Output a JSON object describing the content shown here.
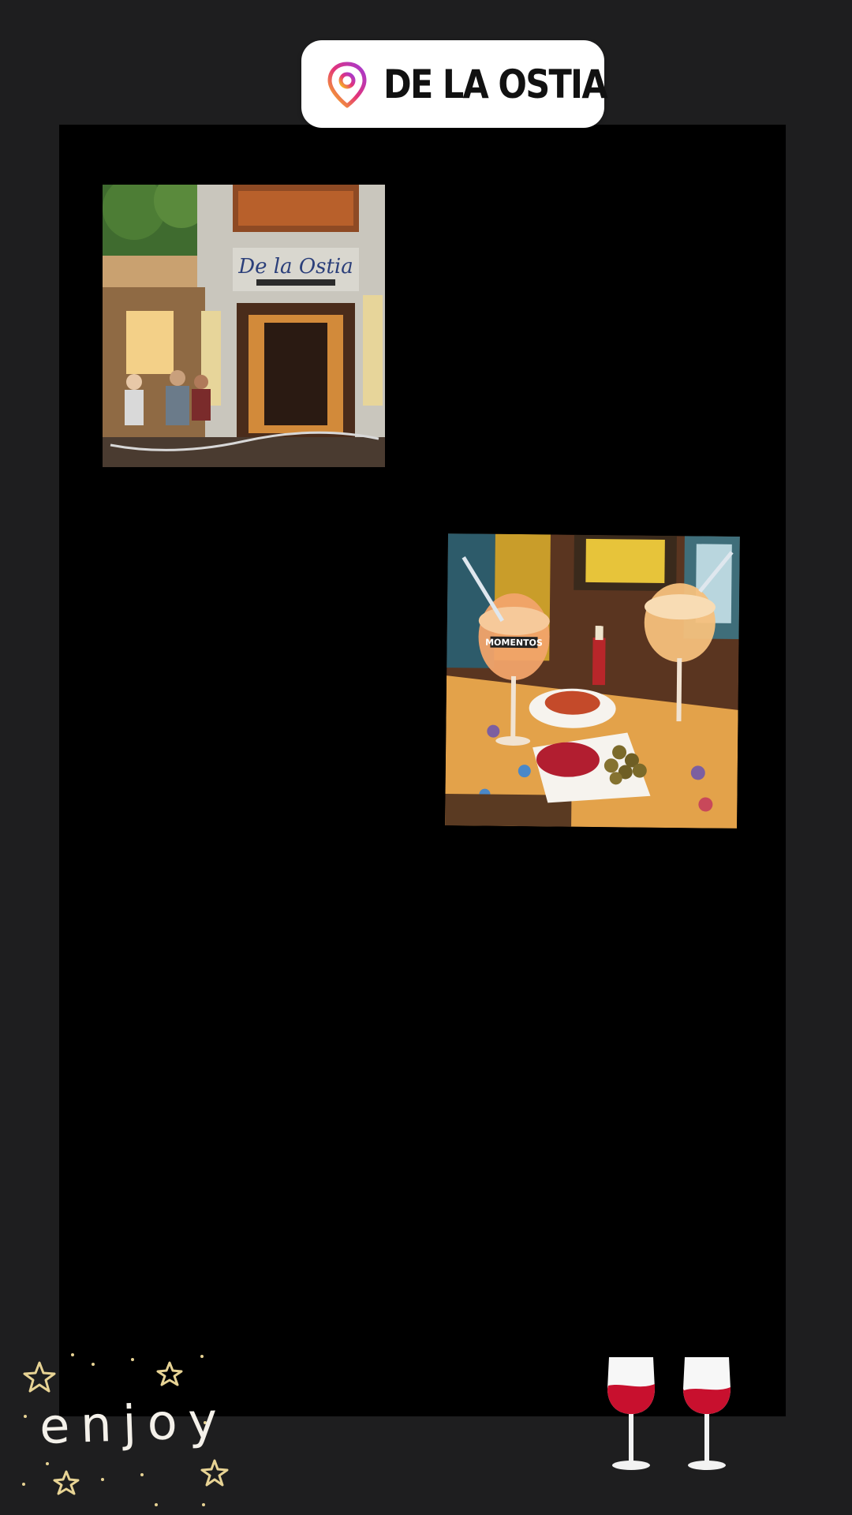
{
  "location_sticker": {
    "label": "DE LA OSTIA",
    "icon": "location-pin-icon",
    "pin_gradient": [
      "#f9c31a",
      "#e3337a",
      "#a23bd6"
    ]
  },
  "photos": [
    {
      "subject": "restaurant-storefront",
      "sign_text": "De la Ostia"
    },
    {
      "subject": "drinks-and-tapas",
      "glass_text": "MOMENTOS"
    }
  ],
  "stickers": {
    "enjoy": {
      "text": "enjoy",
      "icon": "sparkle-stars-icon"
    },
    "wine": {
      "icon": "wine-glasses-icon"
    }
  },
  "colors": {
    "background": "#1e1e1f",
    "frame": "#000000",
    "wine": "#c8102e"
  }
}
